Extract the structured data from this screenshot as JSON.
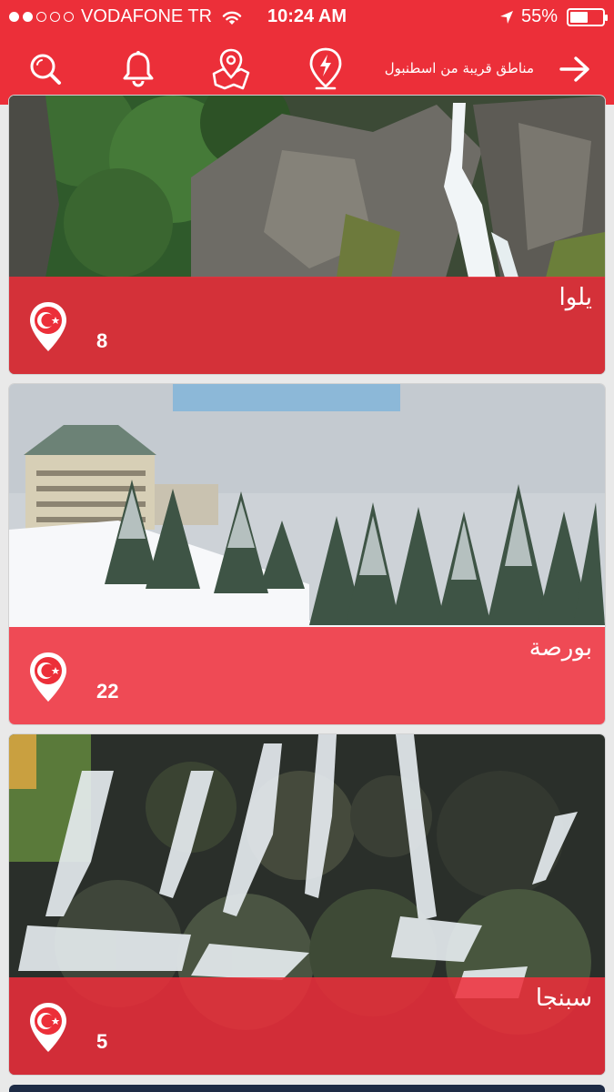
{
  "status_bar": {
    "carrier": "VODAFONE TR",
    "time": "10:24 AM",
    "battery_percent": "55%",
    "battery_level": 0.55,
    "signal_dots_filled": 2,
    "signal_dots_total": 5
  },
  "header": {
    "title": "مناطق قريبة من اسطنبول",
    "icons": [
      "search-icon",
      "bell-icon",
      "map-pin-icon",
      "bolt-pin-icon",
      "arrow-right-icon"
    ]
  },
  "places": [
    {
      "name": "يلوا",
      "count": "8",
      "image": "waterfall-rocks"
    },
    {
      "name": "بورصة",
      "count": "22",
      "image": "snow-forest-hotel"
    },
    {
      "name": "سبنجا",
      "count": "5",
      "image": "cascading-waterfall"
    }
  ],
  "colors": {
    "brand_red": "#ec2f39",
    "band_red": "#ee2d3a",
    "text": "#ffffff"
  }
}
